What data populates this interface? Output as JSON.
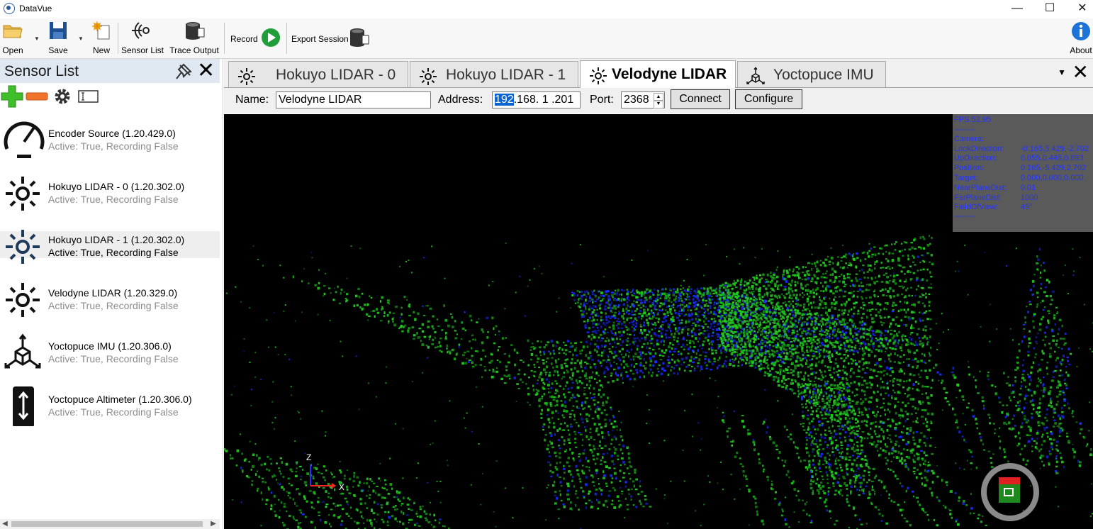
{
  "window": {
    "title": "DataVue",
    "minimize": "—",
    "maximize": "☐",
    "close": "✕"
  },
  "ribbon": {
    "open_label": "Open",
    "save_label": "Save",
    "new_label": "New",
    "sensor_list_label": "Sensor List",
    "trace_output_label": "Trace Output",
    "record_label": "Record",
    "export_session_label": "Export Session",
    "about_label": "About"
  },
  "sensor_panel": {
    "title": "Sensor List",
    "items": [
      {
        "name": "Encoder Source (1.20.429.0)",
        "status": "Active: True, Recording False",
        "icon": "gauge-icon"
      },
      {
        "name": "Hokuyo LIDAR - 0 (1.20.302.0)",
        "status": "Active: True, Recording False",
        "icon": "lidar-icon"
      },
      {
        "name": "Hokuyo LIDAR - 1 (1.20.302.0)",
        "status": "Active: True, Recording False",
        "icon": "lidar-icon"
      },
      {
        "name": "Velodyne LIDAR (1.20.329.0)",
        "status": "Active: True, Recording False",
        "icon": "lidar-icon"
      },
      {
        "name": "Yoctopuce IMU (1.20.306.0)",
        "status": "Active: True, Recording False",
        "icon": "imu-cube-icon"
      },
      {
        "name": "Yoctopuce Altimeter (1.20.306.0)",
        "status": "Active: True, Recording False",
        "icon": "altimeter-icon"
      }
    ]
  },
  "tabs": [
    {
      "label": "Hokuyo LIDAR - 0"
    },
    {
      "label": "Hokuyo LIDAR - 1"
    },
    {
      "label": "Velodyne LIDAR"
    },
    {
      "label": "Yoctopuce IMU"
    }
  ],
  "connection": {
    "name_label": "Name:",
    "name_value": "Velodyne LIDAR",
    "address_label": "Address:",
    "address_octet1": "192",
    "address_rest": ".168. 1 .201",
    "port_label": "Port:",
    "port_value": "2368",
    "connect_label": "Connect",
    "configure_label": "Configure"
  },
  "camera_info": {
    "fps": "FPS:52.95",
    "sep": "--------",
    "camera": "Camera:",
    "rows": [
      {
        "k": "LookDirection:",
        "v": "-0.165,5.429,-2.702"
      },
      {
        "k": "UpDirection:",
        "v": "0.055,0.446,0.893"
      },
      {
        "k": "Position:",
        "v": "0.165,-5.429,2.702"
      },
      {
        "k": "Target:",
        "v": "0.000,0.000,0.000"
      },
      {
        "k": "NearPlaneDist:",
        "v": "0.01"
      },
      {
        "k": "FarPlaneDist:",
        "v": "1000"
      },
      {
        "k": "FieldOfView:",
        "v": "45°"
      }
    ]
  },
  "axes": {
    "z": "Z",
    "x": "X"
  },
  "colors": {
    "accent": "#0a64d6",
    "points_green": "#22cc22",
    "points_blue": "#1a2cff",
    "panel_header": "#dfe7f1"
  }
}
